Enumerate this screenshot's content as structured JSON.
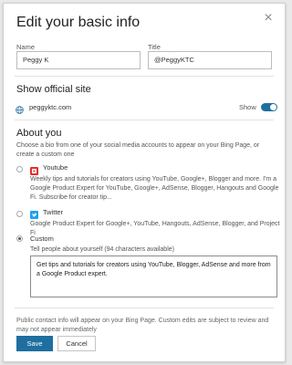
{
  "dialog": {
    "title": "Edit your basic info",
    "close_glyph": "×"
  },
  "fields": {
    "name_label": "Name",
    "name_value": "Peggy K",
    "title_label": "Title",
    "title_value": "@PeggyKTC"
  },
  "official_site": {
    "heading": "Show official site",
    "url": "peggyktc.com",
    "show_label": "Show",
    "show_enabled": true,
    "icon": "globe-icon"
  },
  "about": {
    "heading": "About you",
    "instructions": "Choose a bio from one of your social media accounts to appear on your Bing Page, or create a custom one",
    "options": [
      {
        "source": "Youtube",
        "icon": "youtube-icon",
        "icon_color": "#e52d27",
        "selected": false,
        "bio": "Weekly tips and tutorials for creators using YouTube, Google+, Blogger and more. I'm a Google Product Expert for YouTube, Google+, AdSense, Blogger, Hangouts and Google Fi. Subscribe for creator tip..."
      },
      {
        "source": "Twitter",
        "icon": "twitter-icon",
        "icon_color": "#1da1f2",
        "selected": false,
        "bio": "Google Product Expert for Google+, YouTube, Hangouts, AdSense, Blogger, and Project Fi"
      },
      {
        "source": "Custom",
        "selected": true,
        "prompt": "Tell people about yourself (94 characters available)",
        "value": "Get tips and tutorials for creators using YouTube, Blogger, AdSense and more from a Google Product expert."
      }
    ]
  },
  "footer": {
    "notice": "Public contact info will appear on your Bing Page. Custom edits are subject to review and may not appear immediately",
    "save_label": "Save",
    "cancel_label": "Cancel"
  },
  "colors": {
    "accent": "#1e6fa0"
  }
}
